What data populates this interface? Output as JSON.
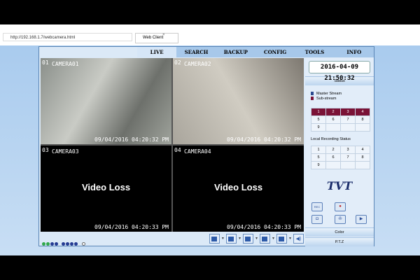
{
  "browser": {
    "url": "http://192.168.1.7/webcamera.html",
    "tab_title": "Web Client",
    "close": "×"
  },
  "tabs": [
    "LIVE",
    "SEARCH",
    "BACKUP",
    "CONFIG",
    "TOOLS",
    "INFO"
  ],
  "cameras": [
    {
      "num": "01",
      "name": "CAMERA01",
      "time": "09/04/2016 04:20:32 PM",
      "loss": ""
    },
    {
      "num": "02",
      "name": "CAMERA02",
      "time": "09/04/2016 04:20:32 PM",
      "loss": ""
    },
    {
      "num": "03",
      "name": "CAMERA03",
      "time": "09/04/2016 04:20:33 PM",
      "loss": "Video Loss"
    },
    {
      "num": "04",
      "name": "CAMERA04",
      "time": "09/04/2016 04:20:33 PM",
      "loss": "Video Loss"
    }
  ],
  "side": {
    "clock": "2016-04-09 21:50:32",
    "status": "Status",
    "master": "Master Stream",
    "sub": "Sub-stream",
    "channels": [
      [
        "1",
        "2",
        "3",
        "4"
      ],
      [
        "5",
        "6",
        "7",
        "8"
      ],
      [
        "9",
        "",
        "",
        ""
      ]
    ],
    "rec_label": "Local Recording Status",
    "rec_channels": [
      [
        "1",
        "2",
        "3",
        "4"
      ],
      [
        "5",
        "6",
        "7",
        "8"
      ],
      [
        "9",
        "",
        "",
        ""
      ]
    ],
    "logo": "TVT",
    "rec_btn": "REC",
    "color": "Color",
    "ptz": "P.T.Z"
  },
  "colors": {
    "master": "#2b4a8f",
    "sub": "#7a1236"
  }
}
